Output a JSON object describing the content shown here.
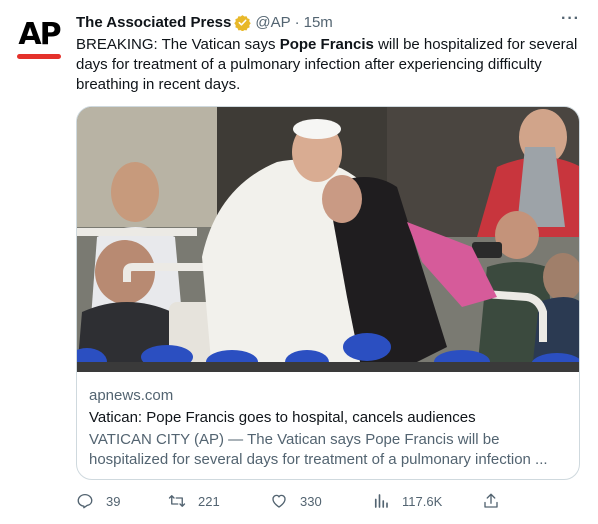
{
  "author": {
    "name": "The Associated Press",
    "handle": "@AP",
    "separator": "·",
    "time": "15m",
    "avatar_text": "AP",
    "brand_color": "#e4312b",
    "verified_badge_color": "#e8b829"
  },
  "more_label": "···",
  "tweet": {
    "text_before": "BREAKING: The Vatican says ",
    "text_bold": "Pope Francis",
    "text_after": " will be hospitalized for several days for treatment of a pulmonary infection after experiencing difficulty breathing in recent days."
  },
  "card": {
    "domain": "apnews.com",
    "title": "Vatican: Pope Francis goes to hospital, cancels audiences",
    "description": "VATICAN CITY (AP) — The Vatican says Pope Francis will be hospitalized for several days for treatment of a pulmonary infection ...",
    "image_subject": "pope-embracing-girl-photo"
  },
  "actions": {
    "replies": "39",
    "retweets": "221",
    "likes": "330",
    "views": "117.6K"
  }
}
